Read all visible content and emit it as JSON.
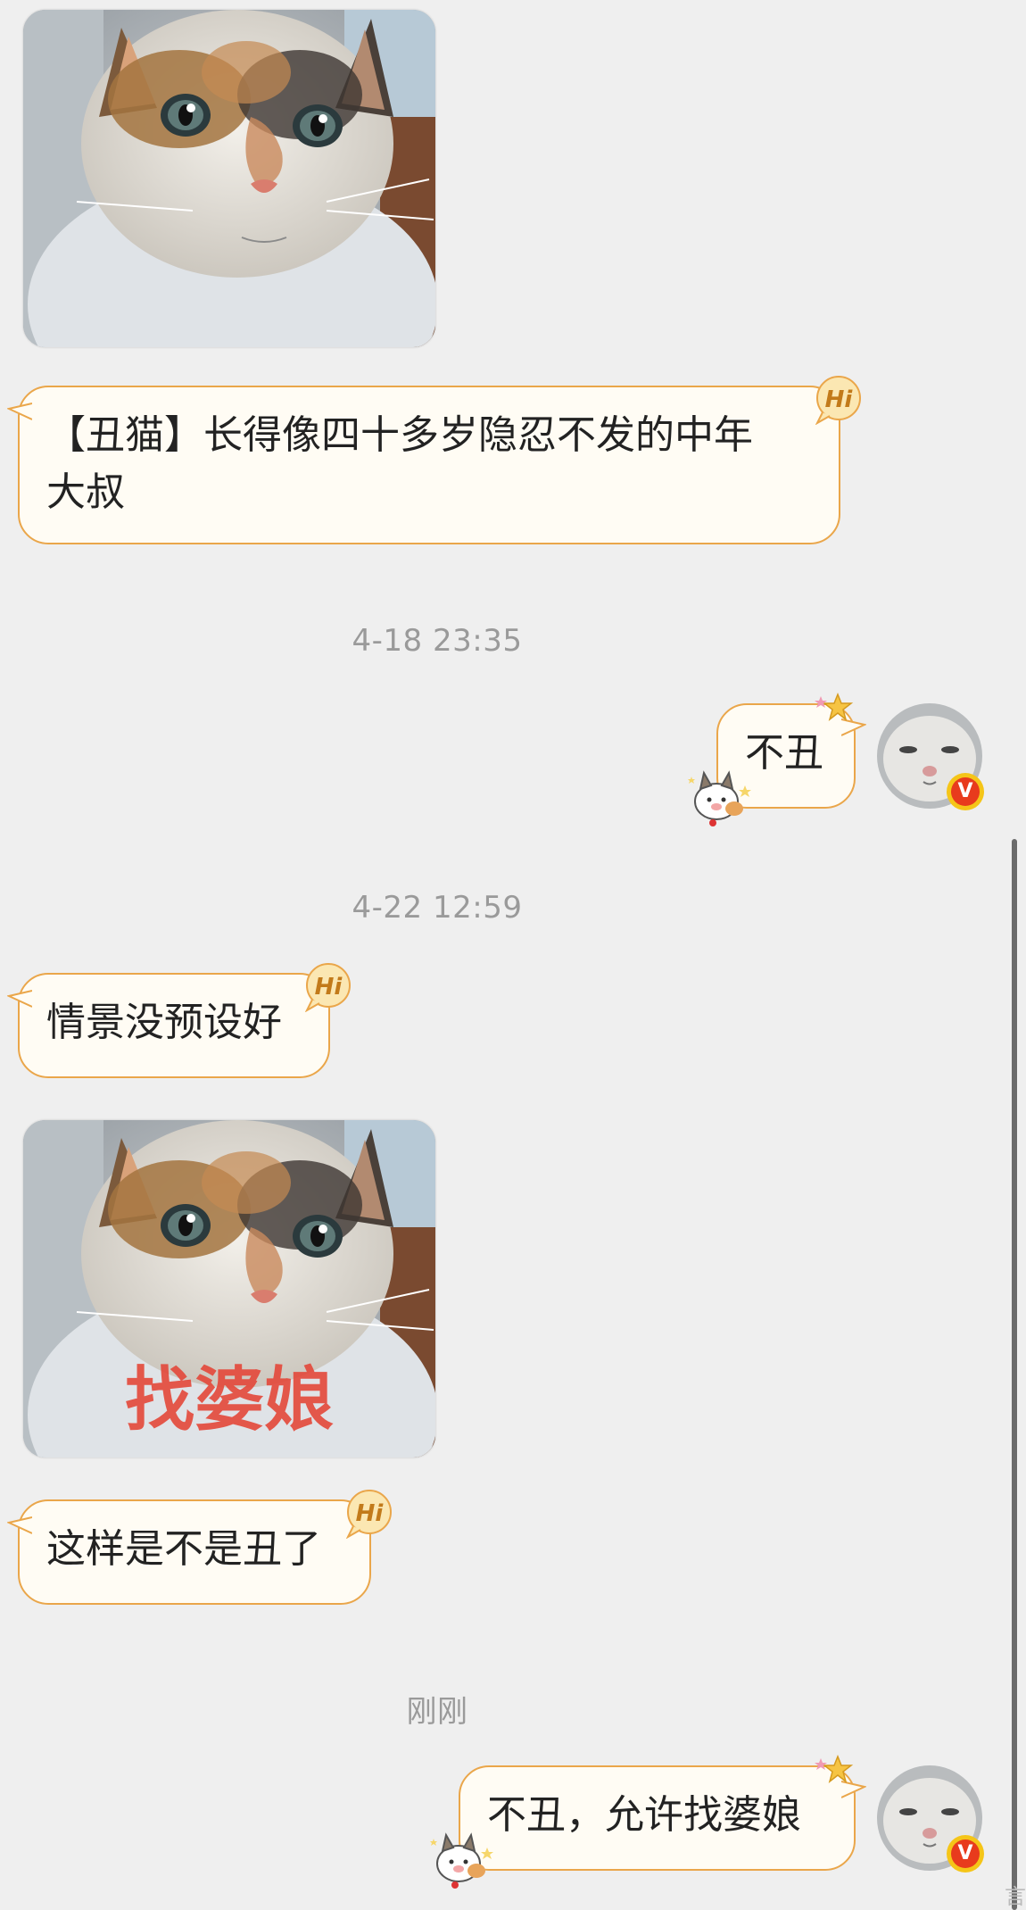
{
  "messages": [
    {
      "id": "m1",
      "type": "image",
      "direction": "incoming",
      "caption": ""
    },
    {
      "id": "m2",
      "type": "text",
      "direction": "incoming",
      "text": "【丑猫】长得像四十多岁隐忍不发的中年\n大叔",
      "badge": "Hi"
    },
    {
      "id": "t1",
      "type": "timestamp",
      "text": "4-18 23:35"
    },
    {
      "id": "m3",
      "type": "text",
      "direction": "outgoing",
      "text": "不丑"
    },
    {
      "id": "t2",
      "type": "timestamp",
      "text": "4-22 12:59"
    },
    {
      "id": "m4",
      "type": "text",
      "direction": "incoming",
      "text": "情景没预设好",
      "badge": "Hi"
    },
    {
      "id": "m5",
      "type": "image",
      "direction": "incoming",
      "caption": "找婆娘"
    },
    {
      "id": "m6",
      "type": "text",
      "direction": "incoming",
      "text": "这样是不是丑了",
      "badge": "Hi"
    },
    {
      "id": "t3",
      "type": "timestamp",
      "text": "刚刚"
    },
    {
      "id": "m7",
      "type": "text",
      "direction": "outgoing",
      "text": "不丑，允许找婆娘"
    }
  ],
  "avatar": {
    "verified_badge": "V",
    "verified_color": "#e83b1d",
    "badge_ring_color": "#f5c518"
  },
  "colors": {
    "background": "#efefef",
    "bubble_fill": "#fffcf4",
    "bubble_border": "#eaa64a",
    "timestamp": "#9a9a9a",
    "caption": "#e4483a"
  },
  "watermark": "言"
}
